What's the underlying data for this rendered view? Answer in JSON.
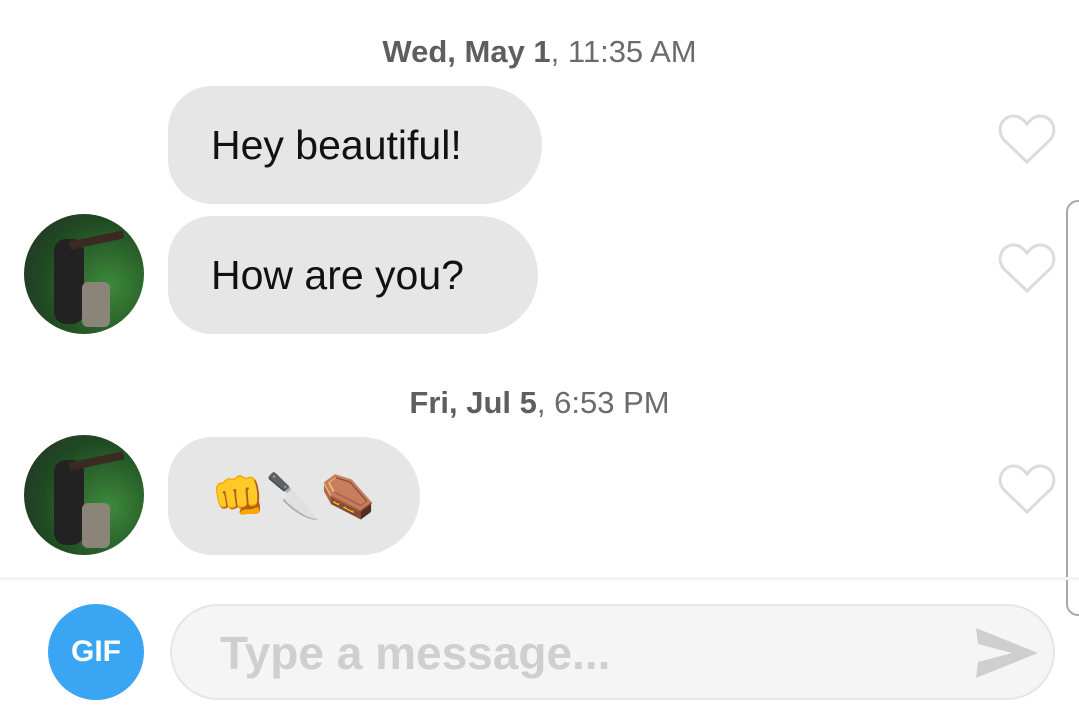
{
  "messages": [
    {
      "date_bold": "Wed, May 1",
      "time": ", 11:35 AM"
    },
    {
      "text": "Hey beautiful!"
    },
    {
      "text": "How are you?"
    },
    {
      "date_bold": "Fri, Jul 5",
      "time": ", 6:53 PM"
    },
    {
      "text": "👊🔪⚰️"
    }
  ],
  "composer": {
    "gif_label": "GIF",
    "placeholder": "Type a message..."
  },
  "colors": {
    "gif": "#3aa6f3",
    "bubble": "#e6e6e6"
  },
  "icons": [
    "heart-icon",
    "send-icon"
  ]
}
